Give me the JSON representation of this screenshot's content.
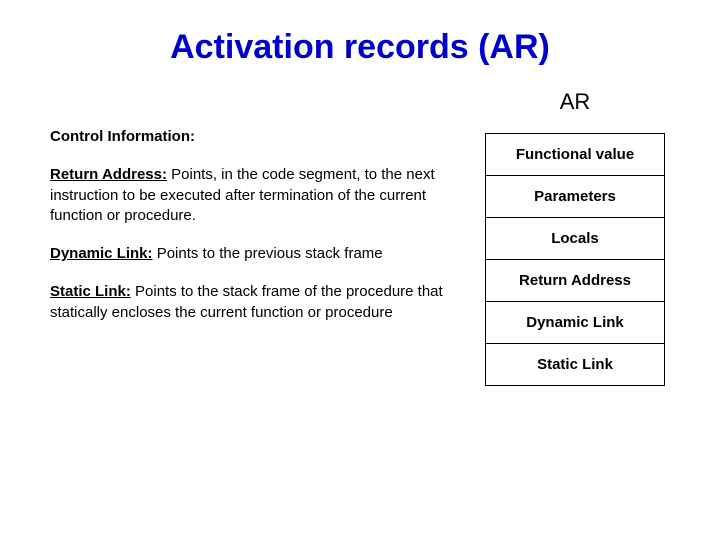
{
  "title": "Activation records (AR)",
  "ar_label": "AR",
  "section_heading": "Control Information:",
  "paragraphs": [
    {
      "term": "Return Address:",
      "text": " Points, in the code segment, to the next instruction to be executed after termination of the current function or procedure."
    },
    {
      "term": "Dynamic Link:",
      "text": " Points to the previous stack frame"
    },
    {
      "term": "Static Link:",
      "text": " Points to the stack frame  of the procedure that statically encloses the current function or procedure"
    }
  ],
  "stack_cells": [
    "Functional value",
    "Parameters",
    "Locals",
    "Return Address",
    "Dynamic Link",
    "Static Link"
  ]
}
